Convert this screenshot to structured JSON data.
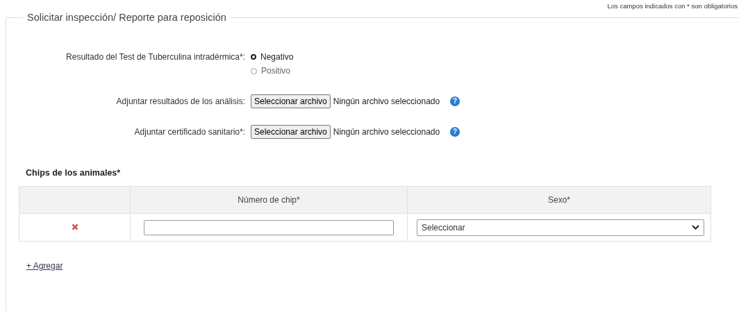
{
  "required_note": "Los campos indicados con * son obligatorios",
  "section": {
    "title": "Solicitar inspección/ Reporte para reposición"
  },
  "test_result": {
    "label": "Resultado del Test de Tuberculina intradérmica*:",
    "options": [
      {
        "label": "Negativo",
        "selected": true
      },
      {
        "label": "Positivo",
        "selected": false
      }
    ]
  },
  "attachments": [
    {
      "label": "Adjuntar resultados de los análisis:",
      "button": "Seleccionar archivo",
      "status": "Ningún archivo seleccionado",
      "help": "?"
    },
    {
      "label": "Adjuntar certificado sanitario*:",
      "button": "Seleccionar archivo",
      "status": "Ningún archivo seleccionado",
      "help": "?"
    }
  ],
  "chips": {
    "title": "Chips de los animales*",
    "columns": [
      "Número de chip*",
      "Sexo*"
    ],
    "rows": [
      {
        "sex": "Seleccionar"
      }
    ]
  },
  "add_link": "+ Agregar"
}
